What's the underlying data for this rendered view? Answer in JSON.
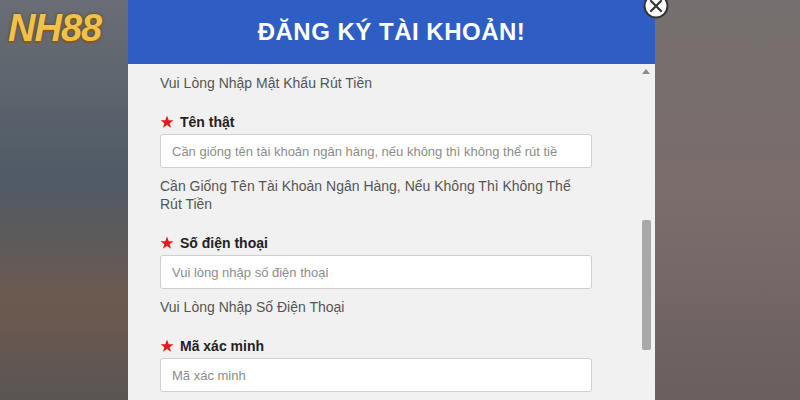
{
  "logo": "NH88",
  "dialog": {
    "title": "ĐĂNG KÝ TÀI KHOẢN!"
  },
  "top_hint": "Vui Lòng Nhập Mật Khẩu Rút Tiền",
  "fields": [
    {
      "label": "Tên thật",
      "required": true,
      "placeholder": "Cần giống tên tài khoản ngân hàng, nếu không thì không thể rút tiề",
      "hint": "Cần Giống Tên Tài Khoản Ngân Hàng, Nếu Không Thì Không Thể Rút Tiền"
    },
    {
      "label": "Số điện thoại",
      "required": true,
      "placeholder": "Vui lòng nhập số điện thoại",
      "hint": "Vui Lòng Nhập Số Điện Thoại"
    },
    {
      "label": "Mã xác minh",
      "required": true,
      "placeholder": "Mã xác minh",
      "hint": ""
    }
  ]
}
